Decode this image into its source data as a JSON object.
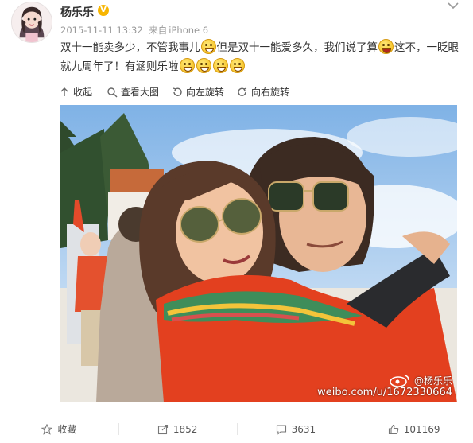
{
  "post": {
    "username": "杨乐乐",
    "verified_badge": "V",
    "timestamp": "2015-11-11 13:32",
    "source_prefix": "来自",
    "source": "iPhone 6",
    "text_1": "双十一能卖多少，不管我事儿",
    "text_2": "但是双十一能爱多久，我们说了算",
    "text_3": "这不，一眨眼就九周年了！有涵则乐啦",
    "emoticons": [
      "smile-emoticon",
      "laugh-emoticon",
      "hug-emoticon",
      "grin-emoticon",
      "grin-emoticon",
      "grin-emoticon"
    ]
  },
  "media_toolbar": {
    "collapse": "收起",
    "view_large": "查看大图",
    "rotate_left": "向左旋转",
    "rotate_right": "向右旋转"
  },
  "watermark": {
    "handle": "@杨乐乐",
    "url": "weibo.com/u/1672330664"
  },
  "actions": {
    "favorite": "收藏",
    "repost_count": "1852",
    "comment_count": "3631",
    "like_count": "101169"
  },
  "colors": {
    "badge": "#f7b500",
    "link": "#eb7350",
    "sky": "#bcd6ef"
  }
}
